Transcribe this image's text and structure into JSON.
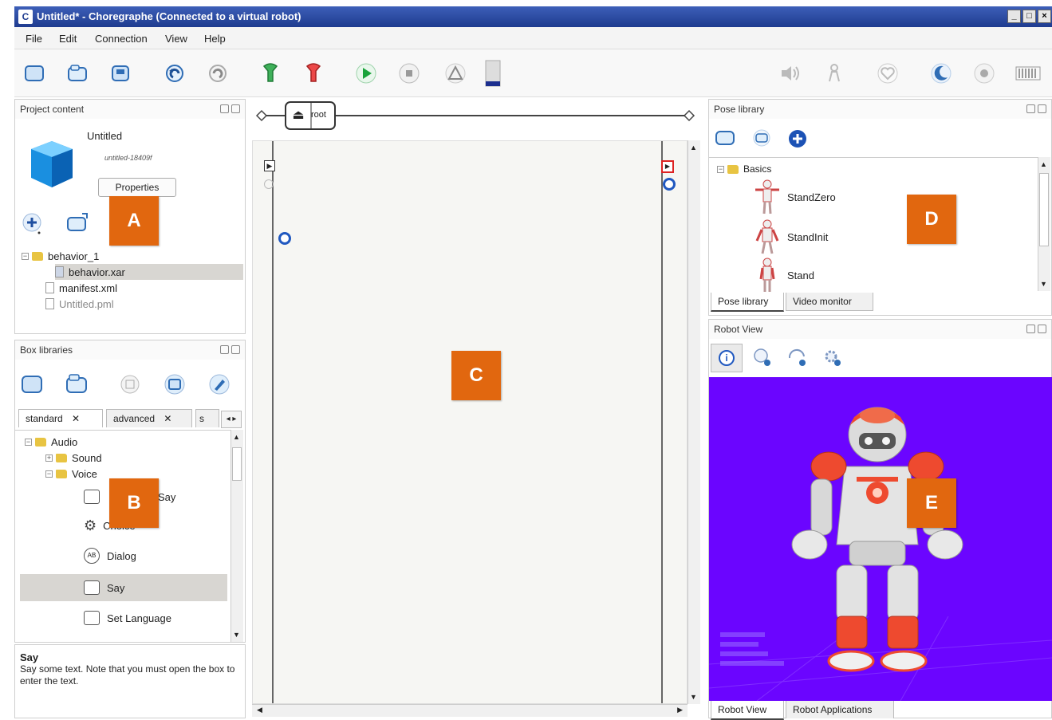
{
  "window": {
    "title": "Untitled* - Choregraphe (Connected to a virtual robot)",
    "app_icon": "C",
    "controls": {
      "minimize": "_",
      "maximize": "□",
      "close": "×"
    }
  },
  "menu": {
    "file": "File",
    "edit": "Edit",
    "connection": "Connection",
    "view": "View",
    "help": "Help"
  },
  "project_content": {
    "header": "Project content",
    "project_name": "Untitled",
    "project_id": "untitled-18409f",
    "properties_label": "Properties",
    "tree": {
      "behavior_folder": "behavior_1",
      "behavior_file": "behavior.xar",
      "manifest": "manifest.xml",
      "pml": "Untitled.pml"
    }
  },
  "box_libraries": {
    "header": "Box libraries",
    "tabs": {
      "standard": "standard",
      "advanced": "advanced",
      "third": "s"
    },
    "tree": {
      "audio": "Audio",
      "sound": "Sound",
      "voice": "Voice",
      "animated_say": "Say",
      "choice": "Choice",
      "dialog": "Dialog",
      "say": "Say",
      "set_language": "Set Language"
    },
    "description": {
      "title": "Say",
      "text": "Say some text. Note that you must open the box to enter the text."
    }
  },
  "flow": {
    "root_label": "root"
  },
  "pose_library": {
    "header": "Pose library",
    "tree": {
      "basics": "Basics",
      "stand_zero": "StandZero",
      "stand_init": "StandInit",
      "stand": "Stand"
    },
    "tabs": {
      "pose_library": "Pose library",
      "video_monitor": "Video monitor"
    }
  },
  "robot_view": {
    "header": "Robot View",
    "tabs": {
      "robot_view": "Robot View",
      "robot_applications": "Robot Applications"
    },
    "info_icon": "i",
    "background_color": "#6b05ff"
  },
  "labels": {
    "a": "A",
    "b": "B",
    "c": "C",
    "d": "D",
    "e": "E"
  },
  "colors": {
    "label_orange": "#e1670f",
    "titlebar_blue": "#1e3b8f",
    "selection": "#d8d6d2"
  }
}
